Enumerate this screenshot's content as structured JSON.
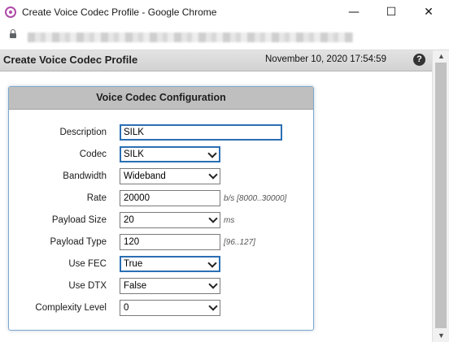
{
  "window": {
    "title": "Create Voice Codec Profile - Google Chrome",
    "minimize_glyph": "—",
    "maximize_glyph": "☐",
    "close_glyph": "✕"
  },
  "page": {
    "title": "Create Voice Codec Profile",
    "datetime": "November 10, 2020 17:54:59",
    "help_glyph": "?"
  },
  "panel": {
    "title": "Voice Codec Configuration",
    "fields": {
      "description": {
        "label": "Description",
        "value": "SILK"
      },
      "codec": {
        "label": "Codec",
        "value": "SILK"
      },
      "bandwidth": {
        "label": "Bandwidth",
        "value": "Wideband"
      },
      "rate": {
        "label": "Rate",
        "value": "20000",
        "hint": "b/s [8000..30000]"
      },
      "payload_size": {
        "label": "Payload Size",
        "value": "20",
        "hint": "ms"
      },
      "payload_type": {
        "label": "Payload Type",
        "value": "120",
        "hint": "[96..127]"
      },
      "use_fec": {
        "label": "Use FEC",
        "value": "True"
      },
      "use_dtx": {
        "label": "Use DTX",
        "value": "False"
      },
      "complexity_level": {
        "label": "Complexity Level",
        "value": "0"
      }
    }
  },
  "scrollbar": {
    "up_glyph": "▲",
    "down_glyph": "▼"
  },
  "colors": {
    "focus_border": "#2b6fb3",
    "panel_header": "#bfbfbf",
    "page_header": "#d9d9d9"
  }
}
